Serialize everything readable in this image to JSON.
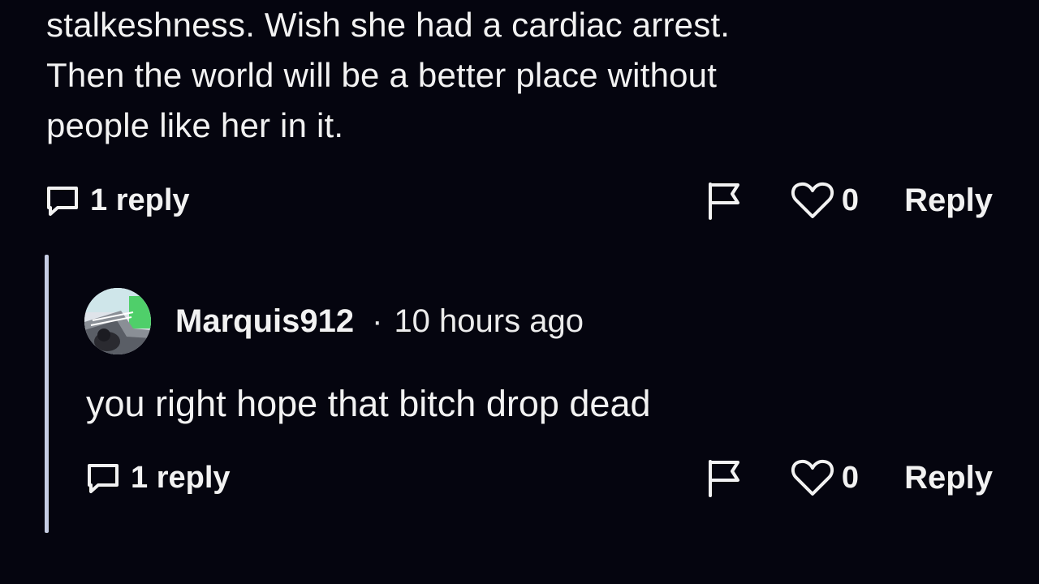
{
  "parent_comment": {
    "lines": [
      "stalkeshness. Wish she had a cardiac arrest.",
      "Then the world will be a better place without",
      "people like her in it."
    ],
    "replies_label": "1 reply",
    "like_count": "0",
    "reply_label": "Reply"
  },
  "reply_comment": {
    "username": "Marquis912",
    "separator": "·",
    "time_ago": "10 hours ago",
    "text": "you right hope that bitch drop dead",
    "replies_label": "1 reply",
    "like_count": "0",
    "reply_label": "Reply"
  },
  "icons": {
    "replies": "comment-icon",
    "report": "flag-icon",
    "like": "heart-icon"
  },
  "colors": {
    "background": "#05050f",
    "text": "#f2f2f2",
    "thread_line": "#c6cde3"
  }
}
